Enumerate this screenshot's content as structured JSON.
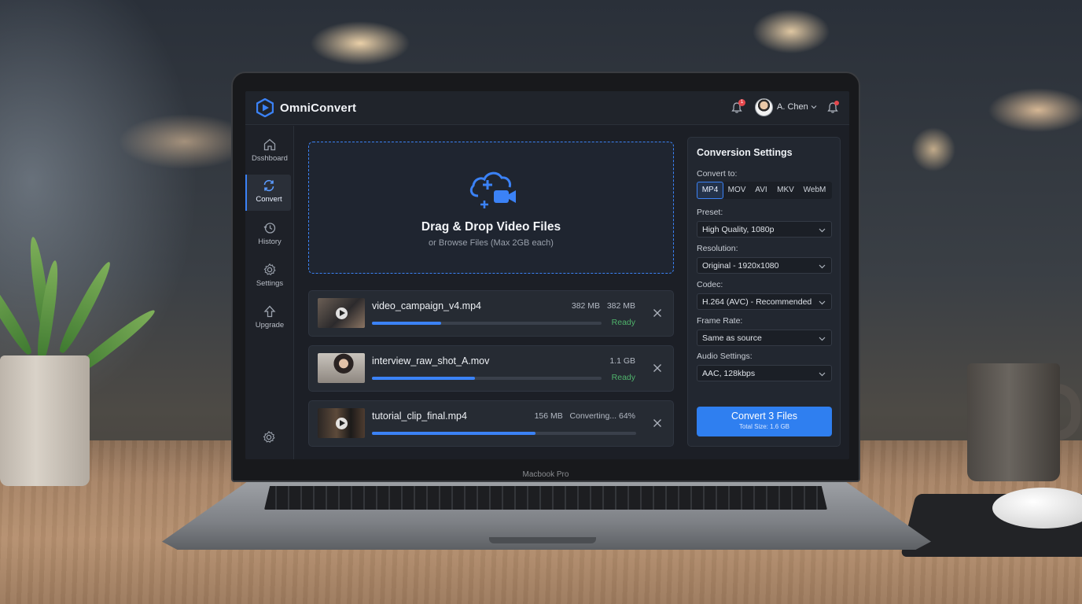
{
  "app": {
    "title": "OmniConvert",
    "notification_count": "1",
    "user_name": "A. Chen"
  },
  "device_label": "Macbook Pro",
  "sidebar": {
    "items": [
      {
        "label": "Dsshboard",
        "icon": "home-icon"
      },
      {
        "label": "Convert",
        "icon": "refresh-icon"
      },
      {
        "label": "History",
        "icon": "history-icon"
      },
      {
        "label": "Settings",
        "icon": "gear-icon"
      },
      {
        "label": "Upgrade",
        "icon": "arrow-up-icon"
      }
    ],
    "active": "Convert"
  },
  "dropzone": {
    "title": "Drag & Drop Video Files",
    "subtitle": "or Browse Files (Max 2GB each)"
  },
  "files": [
    {
      "name": "video_campaign_v4.mp4",
      "size": "382 MB",
      "size_out": "382 MB",
      "status": "Ready",
      "progress": 0.3
    },
    {
      "name": "interview_raw_shot_A.mov",
      "size": "1.1 GB",
      "status": "Ready",
      "progress": 0.45
    },
    {
      "name": "tutorial_clip_final.mp4",
      "size": "156 MB",
      "status": "Converting... 64%",
      "progress": 0.62
    }
  ],
  "settings": {
    "title": "Conversion Settings",
    "convert_to_label": "Convert to:",
    "formats": [
      "MP4",
      "MOV",
      "AVI",
      "MKV",
      "WebM"
    ],
    "selected_format": "MP4",
    "preset_label": "Preset:",
    "preset_value": "High Quality, 1080p",
    "resolution_label": "Resolution:",
    "resolution_value": "Original - 1920x1080",
    "codec_label": "Codec:",
    "codec_value": "H.264 (AVC) - Recommended",
    "frame_rate_label": "Frame Rate:",
    "frame_rate_value": "Same as source",
    "audio_label": "Audio Settings:",
    "audio_value": "AAC, 128kbps",
    "convert_button": "Convert 3 Files",
    "convert_sub": "Total Size: 1.6 GB"
  },
  "colors": {
    "accent": "#3b82f6",
    "ready": "#4fb36b",
    "badge": "#e5484d"
  }
}
